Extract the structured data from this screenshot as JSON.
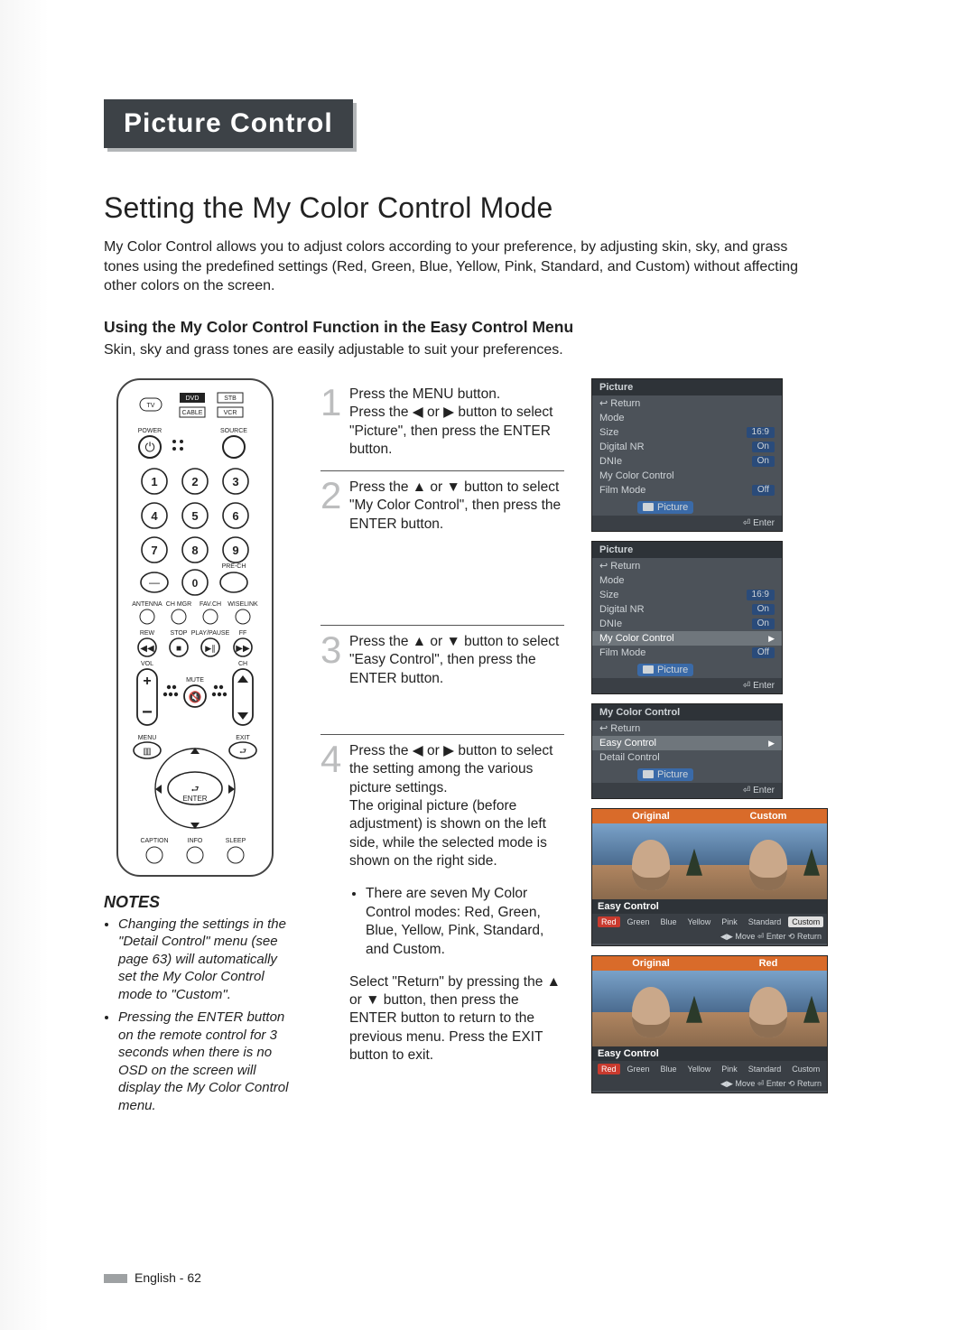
{
  "title_bar": "Picture Control",
  "section_heading": "Setting the My Color Control Mode",
  "intro": "My Color Control allows you to adjust colors according to your preference, by adjusting skin, sky, and grass tones using the predefined settings (Red, Green, Blue, Yellow, Pink, Standard, and Custom) without affecting other colors on the screen.",
  "sub_heading": "Using the My Color Control Function in the Easy Control Menu",
  "sub_text": "Skin, sky and grass tones are easily adjustable to suit your preferences.",
  "remote": {
    "top_buttons": [
      "TV",
      "DVD",
      "STB",
      "CABLE",
      "VCR"
    ],
    "labels": [
      "POWER",
      "SOURCE",
      "PRE-CH",
      "ANTENNA",
      "CH MGR",
      "FAV.CH",
      "WISELINK",
      "REW",
      "STOP",
      "PLAY/PAUSE",
      "FF",
      "VOL",
      "CH",
      "MUTE",
      "MENU",
      "EXIT",
      "ENTER",
      "CAPTION",
      "INFO",
      "SLEEP"
    ],
    "keypad": [
      "1",
      "2",
      "3",
      "4",
      "5",
      "6",
      "7",
      "8",
      "9",
      "0"
    ],
    "dash": "—"
  },
  "notes_head": "NOTES",
  "notes": [
    "Changing the settings in the \"Detail Control\" menu (see page 63) will automatically set the My Color Control mode to \"Custom\".",
    "Pressing the ENTER button on the remote control for 3 seconds when there is no OSD on the screen will display the My Color Control menu."
  ],
  "steps": [
    {
      "n": "1",
      "text": "Press the MENU button.\nPress the ◀ or ▶ button to select \"Picture\", then press the ENTER button."
    },
    {
      "n": "2",
      "text": "Press the ▲ or ▼ button to select \"My Color Control\", then press the ENTER button."
    },
    {
      "n": "3",
      "text": "Press the ▲ or ▼ button to select \"Easy Control\", then press the ENTER button."
    },
    {
      "n": "4",
      "text": "Press the ◀ or ▶ button to select the setting among the various picture settings.\nThe original picture (before adjustment) is shown on the left side, while the selected mode is shown on the right side.",
      "bullet": "There are seven My Color Control modes: Red, Green, Blue, Yellow, Pink, Standard, and Custom.",
      "tail": "Select \"Return\" by pressing the ▲ or ▼ button, then press the ENTER button to return to the previous menu. Press the EXIT button to exit."
    }
  ],
  "osd1": {
    "title": "Picture",
    "return": "Return",
    "rows": [
      {
        "l": "Mode",
        "v": ""
      },
      {
        "l": "Size",
        "v": "16:9"
      },
      {
        "l": "Digital NR",
        "v": "On"
      },
      {
        "l": "DNIe",
        "v": "On"
      },
      {
        "l": "My Color Control",
        "v": ""
      },
      {
        "l": "Film Mode",
        "v": "Off"
      }
    ],
    "chip": "Picture",
    "footer": "Enter"
  },
  "osd2": {
    "title": "Picture",
    "return": "Return",
    "rows": [
      {
        "l": "Mode",
        "v": ""
      },
      {
        "l": "Size",
        "v": "16:9"
      },
      {
        "l": "Digital NR",
        "v": "On"
      },
      {
        "l": "DNIe",
        "v": "On"
      },
      {
        "l": "My Color Control",
        "v": "",
        "sel": true,
        "arrow": true
      },
      {
        "l": "Film Mode",
        "v": "Off"
      }
    ],
    "chip": "Picture",
    "footer": "Enter"
  },
  "osd3": {
    "title": "My Color Control",
    "return": "Return",
    "rows": [
      {
        "l": "Easy Control",
        "v": "",
        "sel": true,
        "arrow": true
      },
      {
        "l": "Detail Control",
        "v": ""
      }
    ],
    "chip": "Picture",
    "footer": "Enter"
  },
  "preview1": {
    "left_label": "Original",
    "right_label": "Custom",
    "ec": "Easy Control",
    "chips": [
      "Red",
      "Green",
      "Blue",
      "Yellow",
      "Pink",
      "Standard",
      "Custom"
    ],
    "sel": "Custom",
    "footer": "◀▶ Move   ⏎ Enter   ⟲ Return"
  },
  "preview2": {
    "left_label": "Original",
    "right_label": "Red",
    "ec": "Easy Control",
    "chips": [
      "Red",
      "Green",
      "Blue",
      "Yellow",
      "Pink",
      "Standard",
      "Custom"
    ],
    "sel": "Red",
    "footer": "◀▶ Move   ⏎ Enter   ⟲ Return"
  },
  "page_foot": "English - 62"
}
